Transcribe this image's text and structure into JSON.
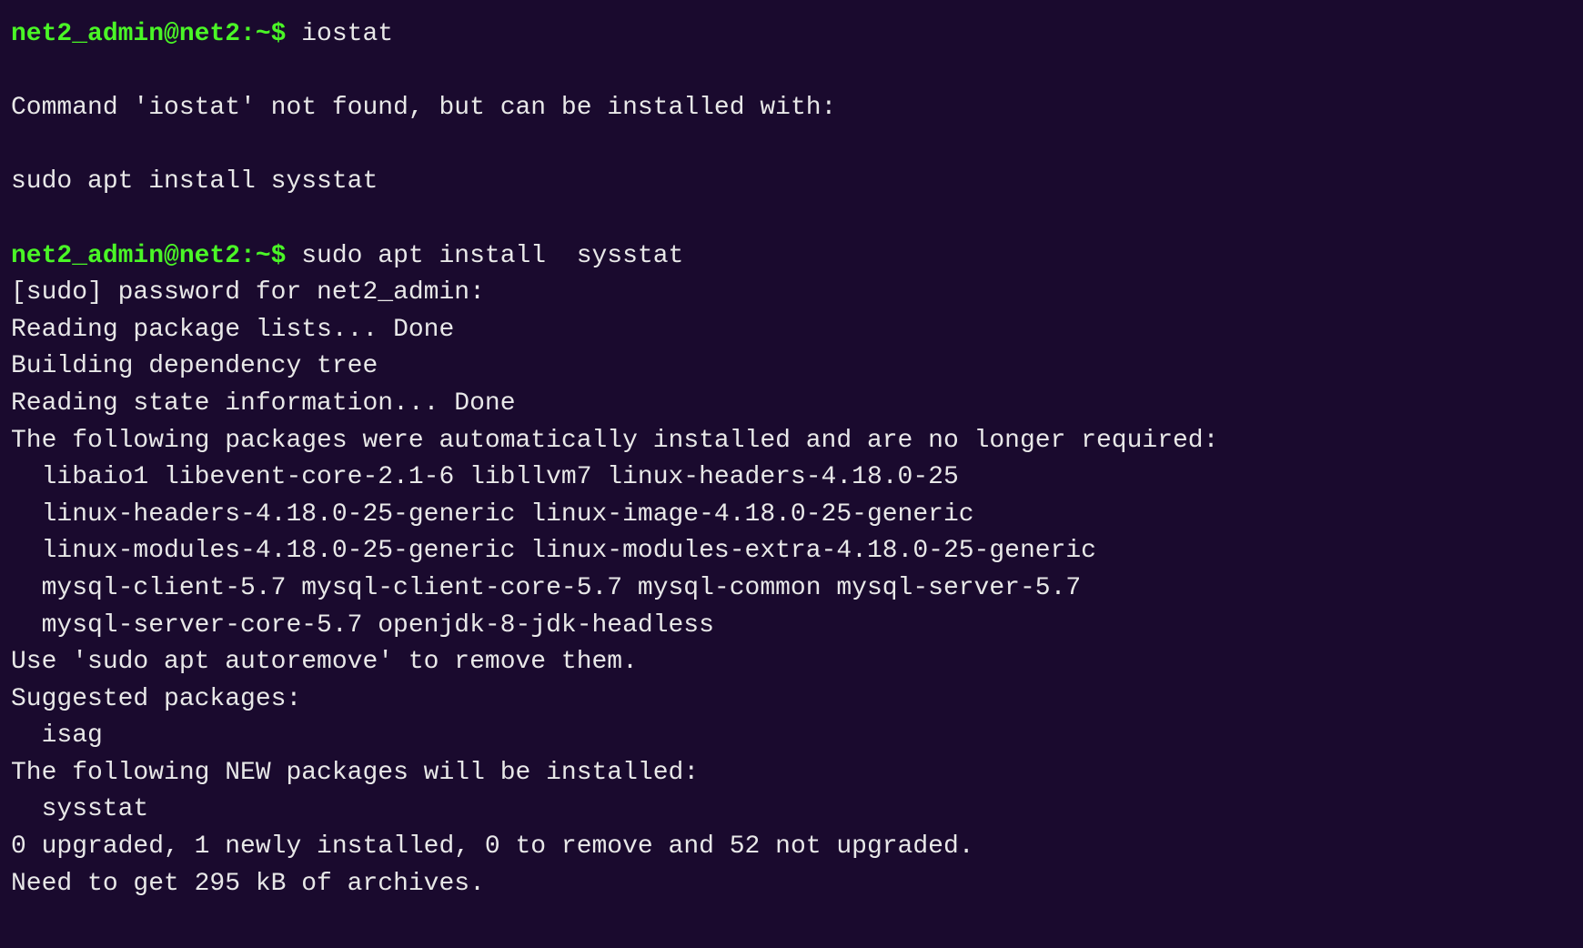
{
  "terminal": {
    "lines": [
      {
        "type": "prompt",
        "prompt": "net2_admin@net2:~$",
        "command": " iostat"
      },
      {
        "type": "empty"
      },
      {
        "type": "normal",
        "text": "Command 'iostat' not found, but can be installed with:"
      },
      {
        "type": "empty"
      },
      {
        "type": "normal",
        "text": "sudo apt install sysstat"
      },
      {
        "type": "empty"
      },
      {
        "type": "prompt",
        "prompt": "net2_admin@net2:~$",
        "command": " sudo apt install  sysstat"
      },
      {
        "type": "normal",
        "text": "[sudo] password for net2_admin:"
      },
      {
        "type": "normal",
        "text": "Reading package lists... Done"
      },
      {
        "type": "normal",
        "text": "Building dependency tree"
      },
      {
        "type": "normal",
        "text": "Reading state information... Done"
      },
      {
        "type": "normal",
        "text": "The following packages were automatically installed and are no longer required:"
      },
      {
        "type": "indented",
        "text": "libaio1 libevent-core-2.1-6 libllvm7 linux-headers-4.18.0-25"
      },
      {
        "type": "indented",
        "text": "linux-headers-4.18.0-25-generic linux-image-4.18.0-25-generic"
      },
      {
        "type": "indented",
        "text": "linux-modules-4.18.0-25-generic linux-modules-extra-4.18.0-25-generic"
      },
      {
        "type": "indented",
        "text": "mysql-client-5.7 mysql-client-core-5.7 mysql-common mysql-server-5.7"
      },
      {
        "type": "indented",
        "text": "mysql-server-core-5.7 openjdk-8-jdk-headless"
      },
      {
        "type": "normal",
        "text": "Use 'sudo apt autoremove' to remove them."
      },
      {
        "type": "normal",
        "text": "Suggested packages:"
      },
      {
        "type": "indented",
        "text": "isag"
      },
      {
        "type": "normal",
        "text": "The following NEW packages will be installed:"
      },
      {
        "type": "indented",
        "text": "sysstat"
      },
      {
        "type": "normal",
        "text": "0 upgraded, 1 newly installed, 0 to remove and 52 not upgraded."
      },
      {
        "type": "normal",
        "text": "Need to get 295 kB of archives."
      }
    ]
  }
}
